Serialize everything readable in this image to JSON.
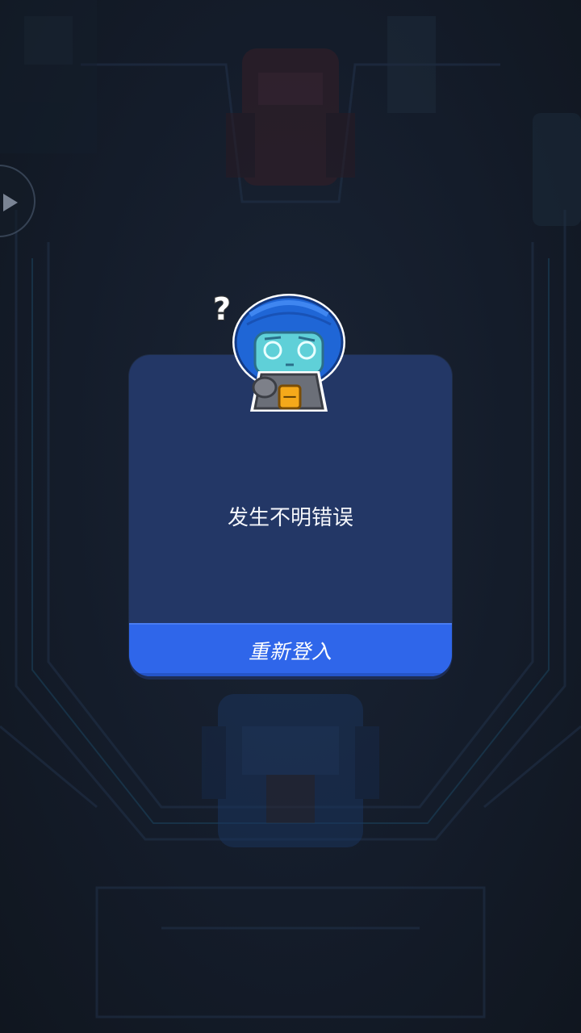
{
  "dialog": {
    "message": "发生不明错误",
    "button_label": "重新登入"
  },
  "mascot": {
    "question_mark": "?",
    "badge_text": "一"
  },
  "colors": {
    "background": "#141b28",
    "dialog_bg": "#233766",
    "button_bg": "#2f66ea",
    "mascot_helmet": "#1f66d6",
    "mascot_visor": "#5fd0d8",
    "mascot_badge": "#f5a91a"
  },
  "icons": {
    "side_button": "play-icon",
    "mascot": "confused-robot-mascot"
  }
}
